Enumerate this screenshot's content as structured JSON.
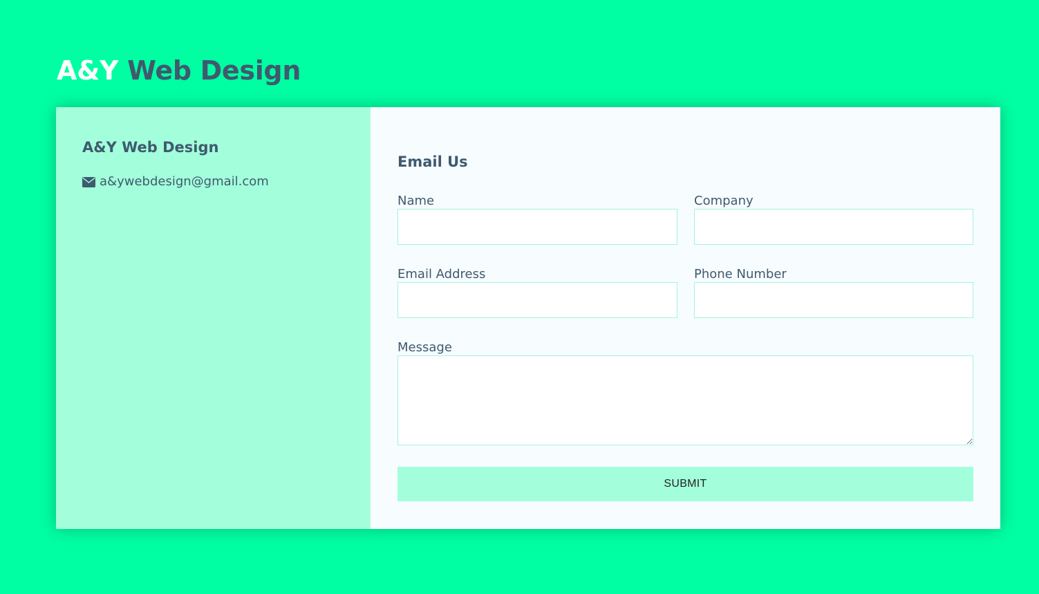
{
  "header": {
    "title_part_a": "A&Y",
    "title_part_b": "Web Design"
  },
  "info": {
    "title": "A&Y Web Design",
    "email": "a&ywebdesign@gmail.com",
    "email_icon": "envelope-icon"
  },
  "form": {
    "title": "Email Us",
    "fields": {
      "name": {
        "label": "Name",
        "value": ""
      },
      "company": {
        "label": "Company",
        "value": ""
      },
      "email": {
        "label": "Email Address",
        "value": ""
      },
      "phone": {
        "label": "Phone Number",
        "value": ""
      },
      "message": {
        "label": "Message",
        "value": ""
      }
    },
    "submit_label": "SUBMIT"
  },
  "colors": {
    "background": "#00ffa3",
    "accent_light": "#a3ffdb",
    "text_dark": "#3f5a6e",
    "form_bg": "#f7fcff",
    "input_border": "#a3f3e0"
  }
}
